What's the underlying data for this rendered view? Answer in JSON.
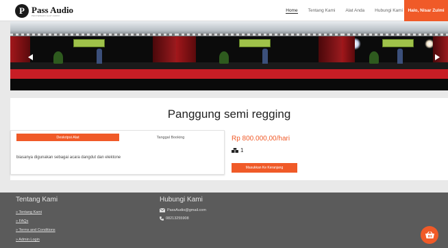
{
  "nav": {
    "logo_letter": "P",
    "logo_title": "Pass Audio",
    "logo_subtitle": "PENYEWAAN ALAT AUDIO",
    "links": [
      "Home",
      "Tentang Kami",
      "Alat Anda",
      "Hubungi Kami"
    ],
    "user": "Halo, Nisar Zulmi"
  },
  "product": {
    "title": "Panggung semi regging",
    "tabs": [
      "Deskripsi Alat",
      "Tanggal Booking"
    ],
    "description": "biasanya digunakan sebagai acara dangdut dan elektone",
    "price": "Rp 800.000,00/hari",
    "stock": "1",
    "cart_button": "Masukkan Ke Keranjang"
  },
  "footer": {
    "about_heading": "Tentang Kami",
    "links": [
      "» Tentang Kami",
      "» FAQs",
      "» Terms and Conditions",
      "» Admin Login"
    ],
    "contact_heading": "Hubungi Kami",
    "email": "PassAudio@gmail.com",
    "phone": "08213255908"
  },
  "colors": {
    "accent": "#f05a28",
    "footer": "#5b5b5b",
    "background": "#e9e9e9"
  },
  "icons": [
    "prev-arrow-icon",
    "next-arrow-icon",
    "boxes-icon",
    "envelope-icon",
    "phone-icon",
    "cart-icon"
  ]
}
